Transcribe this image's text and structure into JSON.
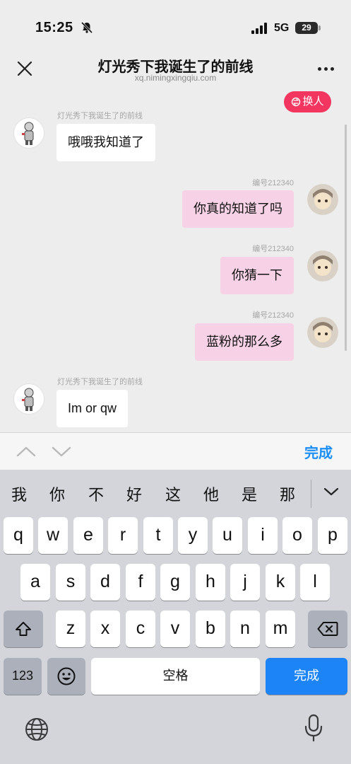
{
  "status": {
    "time": "15:25",
    "network": "5G",
    "battery": "29"
  },
  "nav": {
    "title": "灯光秀下我诞生了的前线",
    "subtitle": "xq.nimingxingqiu.com"
  },
  "swap_button": {
    "label": "换人"
  },
  "messages": [
    {
      "side": "in",
      "sender": "灯光秀下我诞生了的前线",
      "text": "哦哦我知道了"
    },
    {
      "side": "out",
      "sender": "编号212340",
      "text": "你真的知道了吗"
    },
    {
      "side": "out",
      "sender": "编号212340",
      "text": "你猜一下"
    },
    {
      "side": "out",
      "sender": "编号212340",
      "text": "蓝粉的那么多"
    },
    {
      "side": "in",
      "sender": "灯光秀下我诞生了的前线",
      "text": "Im or qw"
    }
  ],
  "accessory": {
    "done_label": "完成"
  },
  "keyboard": {
    "candidates": [
      "我",
      "你",
      "不",
      "好",
      "这",
      "他",
      "是",
      "那"
    ],
    "row1": [
      "q",
      "w",
      "e",
      "r",
      "t",
      "y",
      "u",
      "i",
      "o",
      "p"
    ],
    "row2": [
      "a",
      "s",
      "d",
      "f",
      "g",
      "h",
      "j",
      "k",
      "l"
    ],
    "row3": [
      "z",
      "x",
      "c",
      "v",
      "b",
      "n",
      "m"
    ],
    "numbers_label": "123",
    "space_label": "空格",
    "return_label": "完成"
  },
  "colors": {
    "accent_blue": "#1c84f6",
    "swap_pink": "#f2365f",
    "outgoing_bubble": "#f7d2e6"
  }
}
